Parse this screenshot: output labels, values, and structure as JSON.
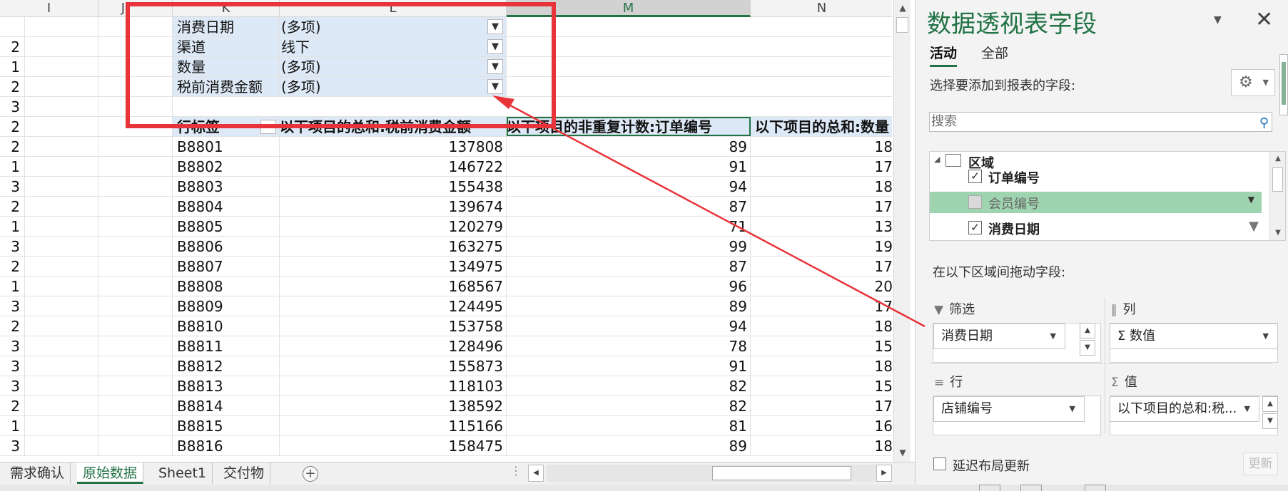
{
  "sheet": {
    "columns": [
      "I",
      "J",
      "K",
      "L",
      "M",
      "N"
    ],
    "selected_column": "M",
    "filters": [
      {
        "label": "消费日期",
        "value": "(多项)"
      },
      {
        "label": "渠道",
        "value": "线下"
      },
      {
        "label": "数量",
        "value": "(多项)"
      },
      {
        "label": "税前消费金额",
        "value": "(多项)"
      }
    ],
    "left_col_values": [
      "",
      "2",
      "1",
      "2",
      "3",
      "2",
      "2",
      "1",
      "3",
      "2",
      "1",
      "3",
      "2",
      "1",
      "3",
      "2",
      "3",
      "3",
      "3",
      "2",
      "1",
      "3"
    ],
    "header": {
      "row_label": "行标签",
      "sum_amount": "以下项目的总和:税前消费金额",
      "distinct_orders": "以下项目的非重复计数:订单编号",
      "sum_qty": "以下项目的总和:数量"
    },
    "rows": [
      {
        "label": "B8801",
        "amount": "137808",
        "orders": "89",
        "qty": "18"
      },
      {
        "label": "B8802",
        "amount": "146722",
        "orders": "91",
        "qty": "17"
      },
      {
        "label": "B8803",
        "amount": "155438",
        "orders": "94",
        "qty": "18"
      },
      {
        "label": "B8804",
        "amount": "139674",
        "orders": "87",
        "qty": "17"
      },
      {
        "label": "B8805",
        "amount": "120279",
        "orders": "71",
        "qty": "13"
      },
      {
        "label": "B8806",
        "amount": "163275",
        "orders": "99",
        "qty": "19"
      },
      {
        "label": "B8807",
        "amount": "134975",
        "orders": "87",
        "qty": "17"
      },
      {
        "label": "B8808",
        "amount": "168567",
        "orders": "96",
        "qty": "20"
      },
      {
        "label": "B8809",
        "amount": "124495",
        "orders": "89",
        "qty": "17"
      },
      {
        "label": "B8810",
        "amount": "153758",
        "orders": "94",
        "qty": "18"
      },
      {
        "label": "B8811",
        "amount": "128496",
        "orders": "78",
        "qty": "15"
      },
      {
        "label": "B8812",
        "amount": "155873",
        "orders": "91",
        "qty": "18"
      },
      {
        "label": "B8813",
        "amount": "118103",
        "orders": "82",
        "qty": "15"
      },
      {
        "label": "B8814",
        "amount": "138592",
        "orders": "82",
        "qty": "17"
      },
      {
        "label": "B8815",
        "amount": "115166",
        "orders": "81",
        "qty": "16"
      },
      {
        "label": "B8816",
        "amount": "158475",
        "orders": "89",
        "qty": "18"
      }
    ]
  },
  "sheet_tabs": {
    "tabs": [
      "需求确认",
      "原始数据",
      "Sheet1",
      "交付物"
    ],
    "active": "原始数据",
    "dots": "⋮"
  },
  "panel": {
    "title": "数据透视表字段",
    "close": "✕",
    "chevron": "▼",
    "tab_active": "活动",
    "tab_all": "全部",
    "choose_fields": "选择要添加到报表的字段:",
    "search_placeholder": "搜索",
    "group_name": "区域",
    "fields": [
      {
        "name": "订单编号",
        "checked": true
      },
      {
        "name": "会员编号",
        "checked": false
      },
      {
        "name": "消费日期",
        "checked": true
      }
    ],
    "drag_label": "在以下区域间拖动字段:",
    "areas": {
      "filter_title": "筛选",
      "filter_item": "消费日期",
      "column_title": "列",
      "column_item": "Σ 数值",
      "row_title": "行",
      "row_item": "店铺编号",
      "value_title": "值",
      "value_item": "以下项目的总和:税..."
    },
    "defer_label": "延迟布局更新",
    "update_button": "更新"
  },
  "colors": {
    "accent": "#217346",
    "annotation": "#e8333a",
    "pivot_fill": "#dde9f6",
    "field_highlight": "#9fd4b0"
  }
}
